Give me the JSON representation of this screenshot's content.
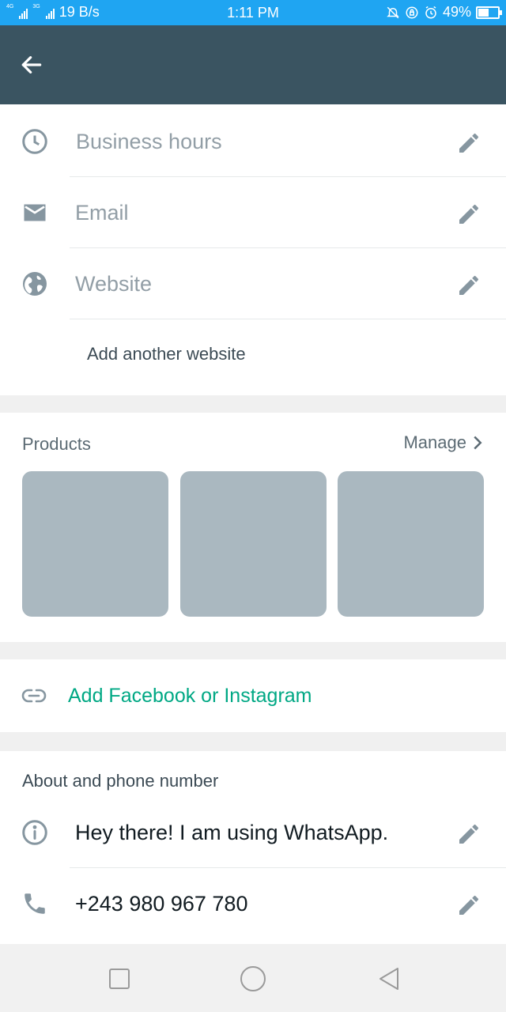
{
  "status_bar": {
    "net_4g": "4G",
    "net_3g": "3G",
    "speed": "19 B/s",
    "time": "1:11 PM",
    "battery": "49%",
    "battery_level": 0.49
  },
  "app_bar": {
    "back_icon": "arrow-left-icon"
  },
  "contact_fields": [
    {
      "icon": "clock-icon",
      "label": "Business hours"
    },
    {
      "icon": "mail-icon",
      "label": "Email"
    },
    {
      "icon": "globe-icon",
      "label": "Website"
    }
  ],
  "add_website_label": "Add another website",
  "products": {
    "title": "Products",
    "manage_label": "Manage",
    "thumbnail_count": 3,
    "placeholder_color": "#aab8c0"
  },
  "social": {
    "icon": "link-icon",
    "label": "Add Facebook or Instagram",
    "color": "#00a884"
  },
  "about": {
    "title": "About and phone number",
    "status": "Hey there! I am using WhatsApp.",
    "phone": "+243 980 967 780"
  },
  "nav_bar": {
    "buttons": [
      "recents-square-icon",
      "home-circle-icon",
      "back-triangle-icon"
    ]
  },
  "colors": {
    "status_bar": "#1fa5f2",
    "app_bar": "#3a5461",
    "accent": "#00a884",
    "icon_gray": "#8696a0"
  }
}
